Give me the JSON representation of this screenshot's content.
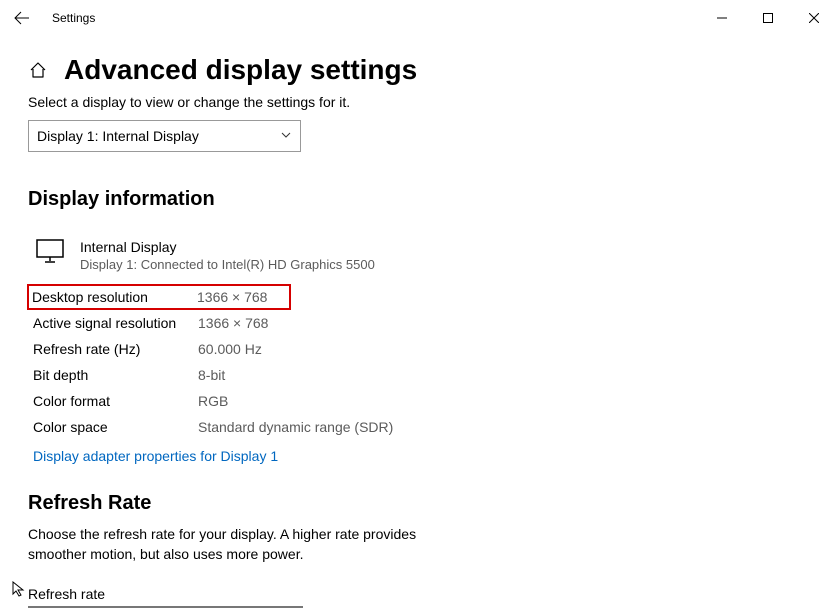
{
  "titlebar": {
    "title": "Settings"
  },
  "page": {
    "title": "Advanced display settings",
    "subtitle": "Select a display to view or change the settings for it."
  },
  "select": {
    "value": "Display 1: Internal Display"
  },
  "section1": {
    "title": "Display information",
    "display_name": "Internal Display",
    "display_sub": "Display 1: Connected to Intel(R) HD Graphics 5500",
    "rows": [
      {
        "label": "Desktop resolution",
        "value": "1366 × 768"
      },
      {
        "label": "Active signal resolution",
        "value": "1366 × 768"
      },
      {
        "label": "Refresh rate (Hz)",
        "value": "60.000 Hz"
      },
      {
        "label": "Bit depth",
        "value": "8-bit"
      },
      {
        "label": "Color format",
        "value": "RGB"
      },
      {
        "label": "Color space",
        "value": "Standard dynamic range (SDR)"
      }
    ],
    "link": "Display adapter properties for Display 1"
  },
  "section2": {
    "title": "Refresh Rate",
    "desc": "Choose the refresh rate for your display. A higher rate provides smoother motion, but also uses more power.",
    "field_label": "Refresh rate"
  }
}
